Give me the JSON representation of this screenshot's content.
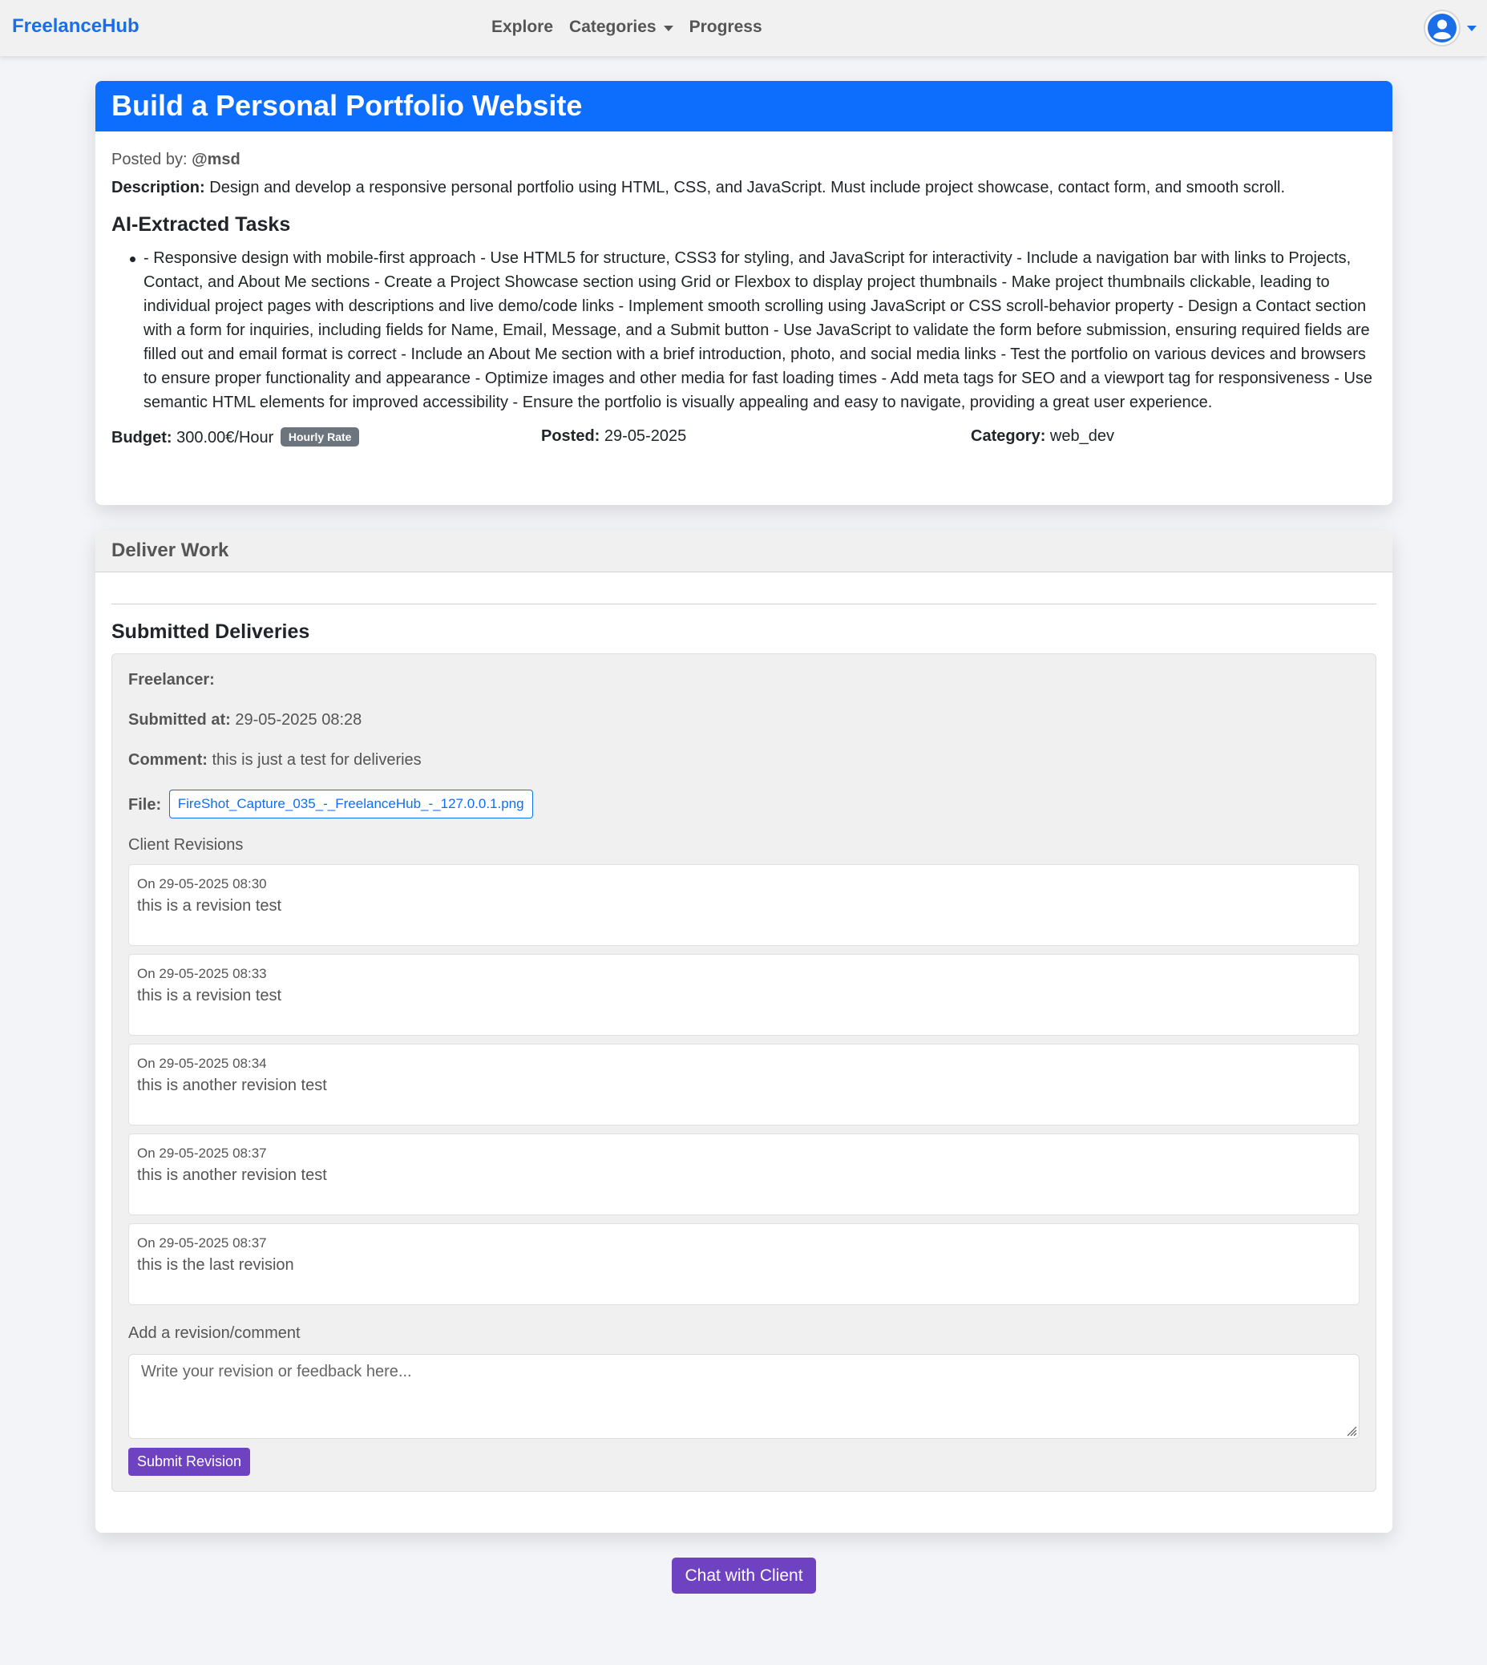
{
  "nav": {
    "brand": "FreelanceHub",
    "links": [
      "Explore",
      "Categories",
      "Progress"
    ]
  },
  "job": {
    "title": "Build a Personal Portfolio Website",
    "posted_by_label": "Posted by:",
    "posted_by": "@msd",
    "description_label": "Description:",
    "description": "Design and develop a responsive personal portfolio using HTML, CSS, and JavaScript. Must include project showcase, contact form, and smooth scroll.",
    "tasks_title": "AI-Extracted Tasks",
    "tasks_text": "- Responsive design with mobile-first approach - Use HTML5 for structure, CSS3 for styling, and JavaScript for interactivity - Include a navigation bar with links to Projects, Contact, and About Me sections - Create a Project Showcase section using Grid or Flexbox to display project thumbnails - Make project thumbnails clickable, leading to individual project pages with descriptions and live demo/code links - Implement smooth scrolling using JavaScript or CSS scroll-behavior property - Design a Contact section with a form for inquiries, including fields for Name, Email, Message, and a Submit button - Use JavaScript to validate the form before submission, ensuring required fields are filled out and email format is correct - Include an About Me section with a brief introduction, photo, and social media links - Test the portfolio on various devices and browsers to ensure proper functionality and appearance - Optimize images and other media for fast loading times - Add meta tags for SEO and a viewport tag for responsiveness - Use semantic HTML elements for improved accessibility - Ensure the portfolio is visually appealing and easy to navigate, providing a great user experience.",
    "budget_label": "Budget:",
    "budget": "300.00€/Hour",
    "rate_badge": "Hourly Rate",
    "posted_label": "Posted:",
    "posted_date": "29-05-2025",
    "category_label": "Category:",
    "category": "web_dev"
  },
  "deliver": {
    "header": "Deliver Work",
    "submitted_title": "Submitted Deliveries",
    "freelancer_label": "Freelancer:",
    "freelancer": "",
    "submitted_at_label": "Submitted at:",
    "submitted_at": "29-05-2025 08:28",
    "comment_label": "Comment:",
    "comment": "this is just a test for deliveries",
    "file_label": "File:",
    "file_name": "FireShot_Capture_035_-_FreelanceHub_-_127.0.0.1.png",
    "revisions_title": "Client Revisions",
    "revisions": [
      {
        "date": "On 29-05-2025 08:30",
        "text": "this is a revision test"
      },
      {
        "date": "On 29-05-2025 08:33",
        "text": "this is a revision test"
      },
      {
        "date": "On 29-05-2025 08:34",
        "text": "this is another revision test"
      },
      {
        "date": "On 29-05-2025 08:37",
        "text": "this is another revision test"
      },
      {
        "date": "On 29-05-2025 08:37",
        "text": "this is the last revision"
      }
    ],
    "add_label": "Add a revision/comment",
    "textarea_placeholder": "Write your revision or feedback here...",
    "submit_label": "Submit Revision"
  },
  "chat_button": "Chat with Client",
  "colors": {
    "brand": "#1a6ee8",
    "header_blue": "#0d6efd",
    "button_purple": "#6f42c1",
    "badge_gray": "#6c757d"
  },
  "icons": [
    "user-avatar-icon",
    "caret-down-icon",
    "resize-grip-icon"
  ]
}
